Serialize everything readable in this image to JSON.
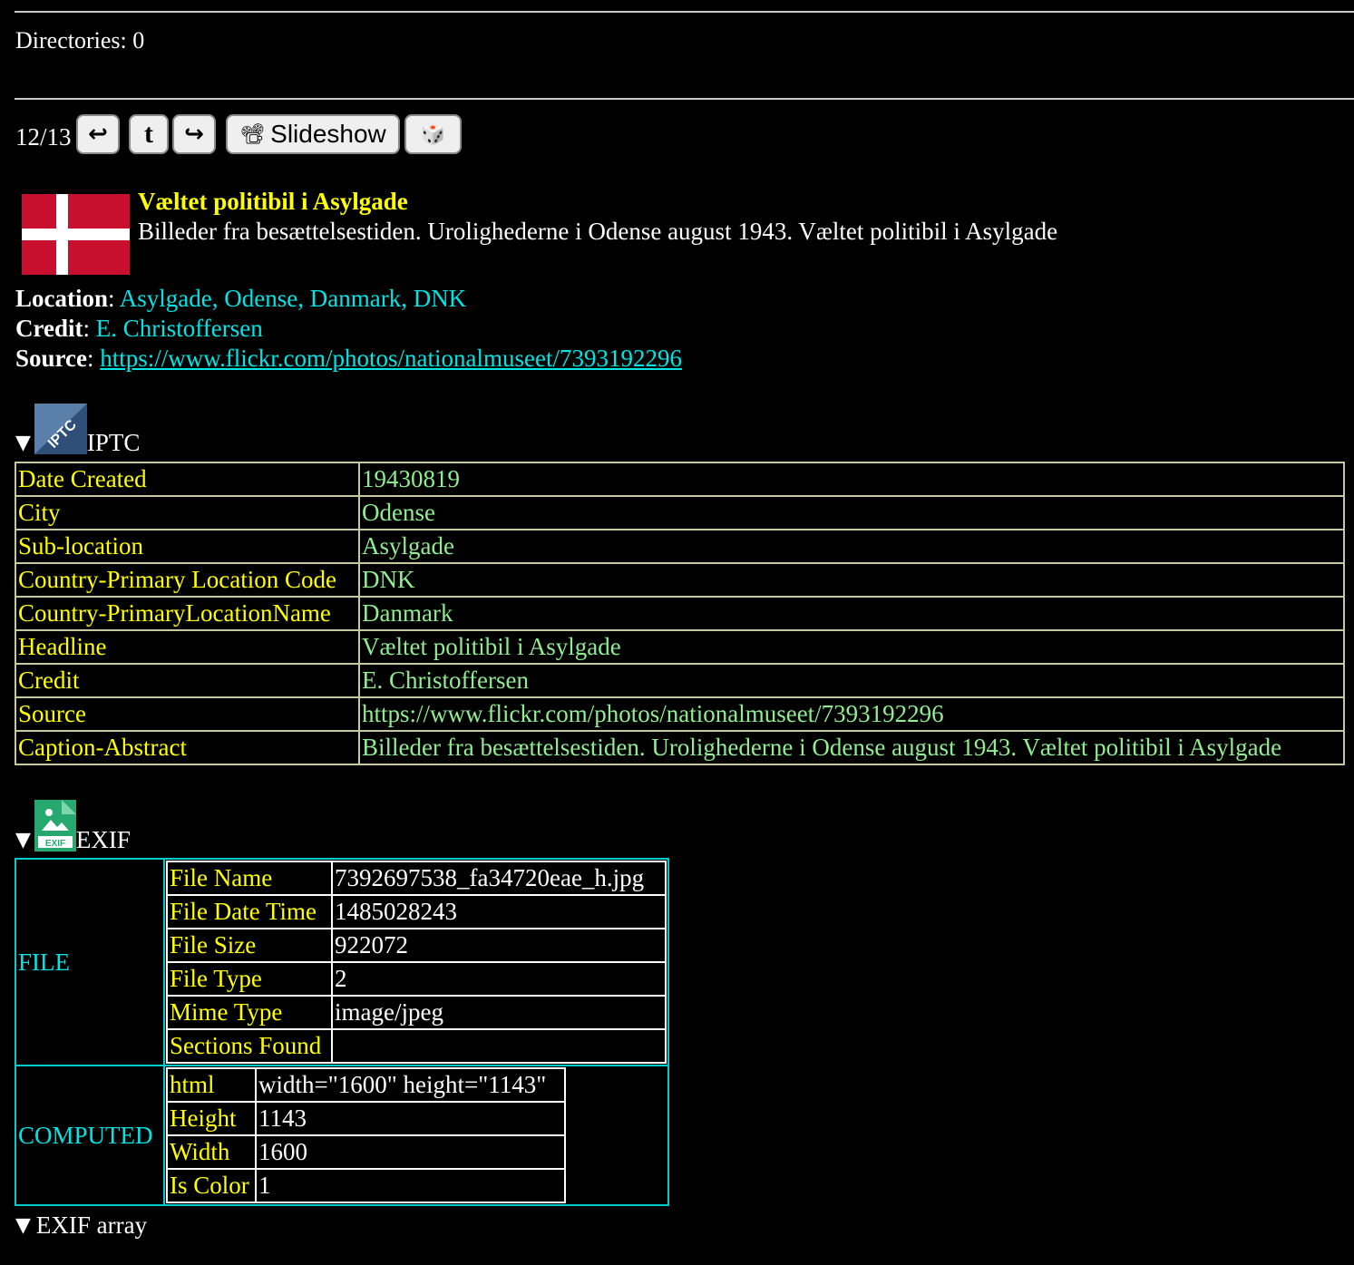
{
  "directories_label": "Directories: 0",
  "nav": {
    "counter": "12/13",
    "prev_glyph": "↩",
    "up_glyph": "t",
    "next_glyph": "↪",
    "slideshow_label": "Slideshow",
    "slideshow_glyph": "📽",
    "random_glyph": "🎲"
  },
  "photo": {
    "title": "Væltet politibil i Asylgade",
    "description": "Billeder fra besættelsestiden. Urolighederne i Odense august 1943. Væltet politibil i Asylgade",
    "flag_colors": {
      "red": "#c8102e",
      "white": "#ffffff"
    }
  },
  "meta": {
    "location_label": "Location",
    "location_value": "Asylgade, Odense, Danmark, DNK",
    "credit_label": "Credit",
    "credit_value": "E. Christoffersen",
    "source_label": "Source",
    "source_value": "https://www.flickr.com/photos/nationalmuseet/7393192296"
  },
  "iptc": {
    "heading": "IPTC",
    "icon_text": "IPTC",
    "rows": [
      {
        "key": "Date Created",
        "value": "19430819"
      },
      {
        "key": "City",
        "value": "Odense"
      },
      {
        "key": "Sub-location",
        "value": "Asylgade"
      },
      {
        "key": "Country-Primary Location Code",
        "value": "DNK"
      },
      {
        "key": "Country-PrimaryLocationName",
        "value": "Danmark"
      },
      {
        "key": "Headline",
        "value": "Væltet politibil i Asylgade"
      },
      {
        "key": "Credit",
        "value": "E. Christoffersen"
      },
      {
        "key": "Source",
        "value": "https://www.flickr.com/photos/nationalmuseet/7393192296"
      },
      {
        "key": "Caption-Abstract",
        "value": "Billeder fra besættelsestiden. Urolighederne i Odense august 1943. Væltet politibil i Asylgade"
      }
    ]
  },
  "exif": {
    "heading": "EXIF",
    "icon_text": "EXIF",
    "file_group": "FILE",
    "file_rows": [
      {
        "key": "File Name",
        "value": "7392697538_fa34720eae_h.jpg"
      },
      {
        "key": "File Date Time",
        "value": "1485028243"
      },
      {
        "key": "File Size",
        "value": "922072"
      },
      {
        "key": "File Type",
        "value": "2"
      },
      {
        "key": "Mime Type",
        "value": "image/jpeg"
      },
      {
        "key": "Sections Found",
        "value": ""
      }
    ],
    "computed_group": "COMPUTED",
    "computed_rows": [
      {
        "key": "html",
        "value": "width=\"1600\" height=\"1143\""
      },
      {
        "key": "Height",
        "value": "1143"
      },
      {
        "key": "Width",
        "value": "1600"
      },
      {
        "key": "Is Color",
        "value": "1"
      }
    ],
    "array_label": "EXIF array"
  },
  "triangle": "▼"
}
